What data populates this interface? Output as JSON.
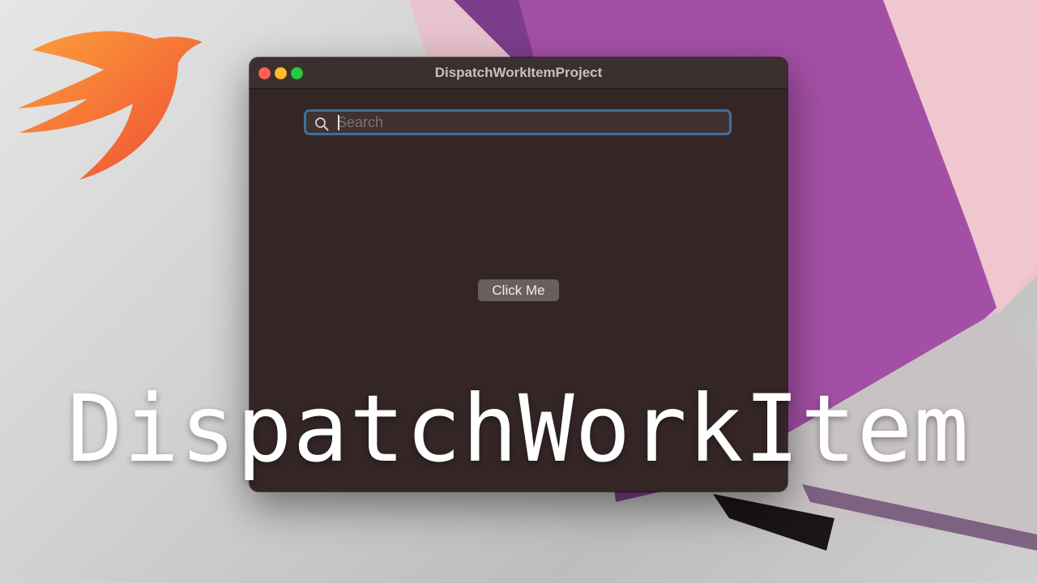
{
  "window": {
    "title": "DispatchWorkItemProject"
  },
  "search": {
    "placeholder": "Search",
    "value": ""
  },
  "button": {
    "label": "Click Me"
  },
  "overlay": {
    "title": "DispatchWorkItem"
  },
  "icons": {
    "logo": "swift-bird-logo",
    "search": "magnifying-glass-icon",
    "close": "close-traffic-light",
    "minimize": "minimize-traffic-light",
    "zoom": "zoom-traffic-light"
  },
  "colors": {
    "window_bg": "#352626",
    "focus_ring": "#3f6f99",
    "button_bg": "#6a5f5e",
    "swift_orange": "#f05138",
    "wallpaper_purple": "#9a4fa3"
  }
}
